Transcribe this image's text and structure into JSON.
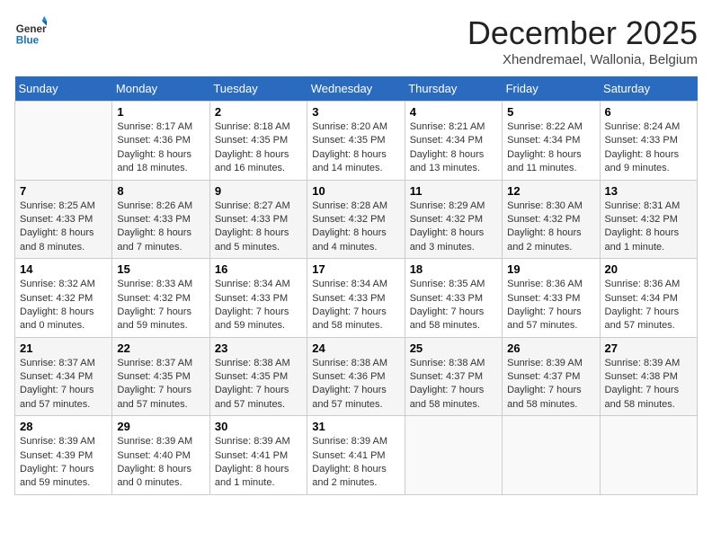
{
  "header": {
    "logo_general": "General",
    "logo_blue": "Blue",
    "month_title": "December 2025",
    "subtitle": "Xhendremael, Wallonia, Belgium"
  },
  "days_of_week": [
    "Sunday",
    "Monday",
    "Tuesday",
    "Wednesday",
    "Thursday",
    "Friday",
    "Saturday"
  ],
  "weeks": [
    [
      {
        "day": "",
        "sunrise": "",
        "sunset": "",
        "daylight": ""
      },
      {
        "day": "1",
        "sunrise": "Sunrise: 8:17 AM",
        "sunset": "Sunset: 4:36 PM",
        "daylight": "Daylight: 8 hours and 18 minutes."
      },
      {
        "day": "2",
        "sunrise": "Sunrise: 8:18 AM",
        "sunset": "Sunset: 4:35 PM",
        "daylight": "Daylight: 8 hours and 16 minutes."
      },
      {
        "day": "3",
        "sunrise": "Sunrise: 8:20 AM",
        "sunset": "Sunset: 4:35 PM",
        "daylight": "Daylight: 8 hours and 14 minutes."
      },
      {
        "day": "4",
        "sunrise": "Sunrise: 8:21 AM",
        "sunset": "Sunset: 4:34 PM",
        "daylight": "Daylight: 8 hours and 13 minutes."
      },
      {
        "day": "5",
        "sunrise": "Sunrise: 8:22 AM",
        "sunset": "Sunset: 4:34 PM",
        "daylight": "Daylight: 8 hours and 11 minutes."
      },
      {
        "day": "6",
        "sunrise": "Sunrise: 8:24 AM",
        "sunset": "Sunset: 4:33 PM",
        "daylight": "Daylight: 8 hours and 9 minutes."
      }
    ],
    [
      {
        "day": "7",
        "sunrise": "Sunrise: 8:25 AM",
        "sunset": "Sunset: 4:33 PM",
        "daylight": "Daylight: 8 hours and 8 minutes."
      },
      {
        "day": "8",
        "sunrise": "Sunrise: 8:26 AM",
        "sunset": "Sunset: 4:33 PM",
        "daylight": "Daylight: 8 hours and 7 minutes."
      },
      {
        "day": "9",
        "sunrise": "Sunrise: 8:27 AM",
        "sunset": "Sunset: 4:33 PM",
        "daylight": "Daylight: 8 hours and 5 minutes."
      },
      {
        "day": "10",
        "sunrise": "Sunrise: 8:28 AM",
        "sunset": "Sunset: 4:32 PM",
        "daylight": "Daylight: 8 hours and 4 minutes."
      },
      {
        "day": "11",
        "sunrise": "Sunrise: 8:29 AM",
        "sunset": "Sunset: 4:32 PM",
        "daylight": "Daylight: 8 hours and 3 minutes."
      },
      {
        "day": "12",
        "sunrise": "Sunrise: 8:30 AM",
        "sunset": "Sunset: 4:32 PM",
        "daylight": "Daylight: 8 hours and 2 minutes."
      },
      {
        "day": "13",
        "sunrise": "Sunrise: 8:31 AM",
        "sunset": "Sunset: 4:32 PM",
        "daylight": "Daylight: 8 hours and 1 minute."
      }
    ],
    [
      {
        "day": "14",
        "sunrise": "Sunrise: 8:32 AM",
        "sunset": "Sunset: 4:32 PM",
        "daylight": "Daylight: 8 hours and 0 minutes."
      },
      {
        "day": "15",
        "sunrise": "Sunrise: 8:33 AM",
        "sunset": "Sunset: 4:32 PM",
        "daylight": "Daylight: 7 hours and 59 minutes."
      },
      {
        "day": "16",
        "sunrise": "Sunrise: 8:34 AM",
        "sunset": "Sunset: 4:33 PM",
        "daylight": "Daylight: 7 hours and 59 minutes."
      },
      {
        "day": "17",
        "sunrise": "Sunrise: 8:34 AM",
        "sunset": "Sunset: 4:33 PM",
        "daylight": "Daylight: 7 hours and 58 minutes."
      },
      {
        "day": "18",
        "sunrise": "Sunrise: 8:35 AM",
        "sunset": "Sunset: 4:33 PM",
        "daylight": "Daylight: 7 hours and 58 minutes."
      },
      {
        "day": "19",
        "sunrise": "Sunrise: 8:36 AM",
        "sunset": "Sunset: 4:33 PM",
        "daylight": "Daylight: 7 hours and 57 minutes."
      },
      {
        "day": "20",
        "sunrise": "Sunrise: 8:36 AM",
        "sunset": "Sunset: 4:34 PM",
        "daylight": "Daylight: 7 hours and 57 minutes."
      }
    ],
    [
      {
        "day": "21",
        "sunrise": "Sunrise: 8:37 AM",
        "sunset": "Sunset: 4:34 PM",
        "daylight": "Daylight: 7 hours and 57 minutes."
      },
      {
        "day": "22",
        "sunrise": "Sunrise: 8:37 AM",
        "sunset": "Sunset: 4:35 PM",
        "daylight": "Daylight: 7 hours and 57 minutes."
      },
      {
        "day": "23",
        "sunrise": "Sunrise: 8:38 AM",
        "sunset": "Sunset: 4:35 PM",
        "daylight": "Daylight: 7 hours and 57 minutes."
      },
      {
        "day": "24",
        "sunrise": "Sunrise: 8:38 AM",
        "sunset": "Sunset: 4:36 PM",
        "daylight": "Daylight: 7 hours and 57 minutes."
      },
      {
        "day": "25",
        "sunrise": "Sunrise: 8:38 AM",
        "sunset": "Sunset: 4:37 PM",
        "daylight": "Daylight: 7 hours and 58 minutes."
      },
      {
        "day": "26",
        "sunrise": "Sunrise: 8:39 AM",
        "sunset": "Sunset: 4:37 PM",
        "daylight": "Daylight: 7 hours and 58 minutes."
      },
      {
        "day": "27",
        "sunrise": "Sunrise: 8:39 AM",
        "sunset": "Sunset: 4:38 PM",
        "daylight": "Daylight: 7 hours and 58 minutes."
      }
    ],
    [
      {
        "day": "28",
        "sunrise": "Sunrise: 8:39 AM",
        "sunset": "Sunset: 4:39 PM",
        "daylight": "Daylight: 7 hours and 59 minutes."
      },
      {
        "day": "29",
        "sunrise": "Sunrise: 8:39 AM",
        "sunset": "Sunset: 4:40 PM",
        "daylight": "Daylight: 8 hours and 0 minutes."
      },
      {
        "day": "30",
        "sunrise": "Sunrise: 8:39 AM",
        "sunset": "Sunset: 4:41 PM",
        "daylight": "Daylight: 8 hours and 1 minute."
      },
      {
        "day": "31",
        "sunrise": "Sunrise: 8:39 AM",
        "sunset": "Sunset: 4:41 PM",
        "daylight": "Daylight: 8 hours and 2 minutes."
      },
      {
        "day": "",
        "sunrise": "",
        "sunset": "",
        "daylight": ""
      },
      {
        "day": "",
        "sunrise": "",
        "sunset": "",
        "daylight": ""
      },
      {
        "day": "",
        "sunrise": "",
        "sunset": "",
        "daylight": ""
      }
    ]
  ]
}
